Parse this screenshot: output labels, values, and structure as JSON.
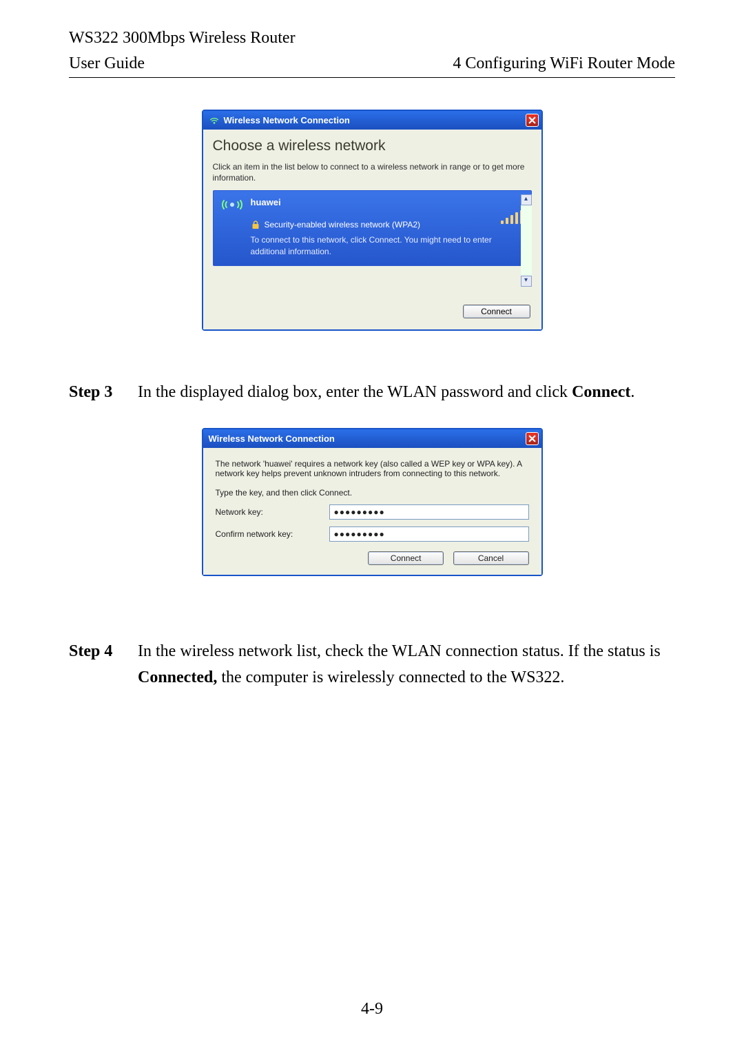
{
  "header": {
    "title": "WS322 300Mbps Wireless Router",
    "left": "User Guide",
    "right": "4 Configuring WiFi Router Mode"
  },
  "dialog1": {
    "title": "Wireless Network Connection",
    "choose_title": "Choose a wireless network",
    "choose_sub": "Click an item in the list below to connect to a wireless network in range or to get more information.",
    "net": {
      "name": "huawei",
      "security": "Security-enabled wireless network (WPA2)",
      "hint": "To connect to this network, click Connect. You might need to enter additional information."
    },
    "connect": "Connect"
  },
  "step3": {
    "label": "Step 3",
    "text_a": "In the displayed dialog box, enter the WLAN password and click ",
    "bold": "Connect",
    "text_b": "."
  },
  "dialog2": {
    "title": "Wireless Network Connection",
    "para": "The network 'huawei' requires a network key (also called a WEP key or WPA key). A network key helps prevent unknown intruders from connecting to this network.",
    "type_hint": "Type the key, and then click Connect.",
    "label_key": "Network key:",
    "label_confirm": "Confirm network key:",
    "value_key": "●●●●●●●●●",
    "value_confirm": "●●●●●●●●●",
    "connect": "Connect",
    "cancel": "Cancel"
  },
  "step4": {
    "label": "Step 4",
    "text_a": "In the wireless network list, check the WLAN connection status. If the status is ",
    "bold": "Connected,",
    "text_b": " the computer is wirelessly connected to the WS322."
  },
  "page_num": "4-9"
}
